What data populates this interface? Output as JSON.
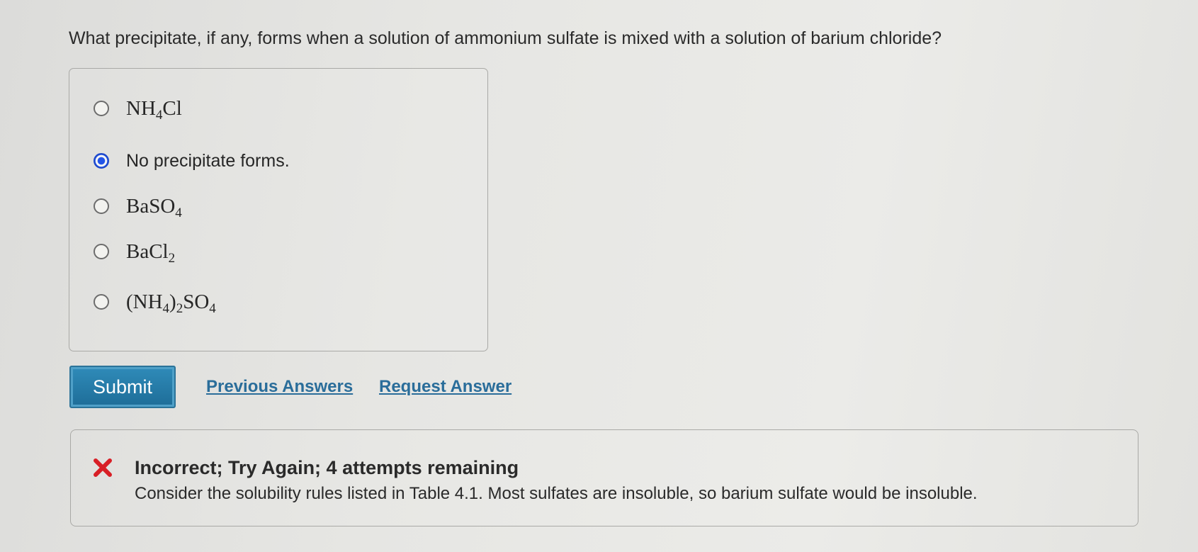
{
  "question": {
    "text": "What precipitate, if any, forms when a solution of ammonium sulfate is mixed with a solution of barium chloride?"
  },
  "options": [
    {
      "parts": [
        "NH",
        "4",
        "Cl"
      ],
      "selected": false
    },
    {
      "text": "No precipitate forms.",
      "selected": true
    },
    {
      "parts": [
        "BaSO",
        "4"
      ],
      "selected": false
    },
    {
      "parts": [
        "BaCl",
        "2"
      ],
      "selected": false
    },
    {
      "parts": [
        "(NH",
        "4",
        ")",
        "2",
        "SO",
        "4"
      ],
      "selected": false
    }
  ],
  "actions": {
    "submit_label": "Submit",
    "previous_answers_label": "Previous Answers",
    "request_answer_label": "Request Answer"
  },
  "feedback": {
    "title": "Incorrect; Try Again; 4 attempts remaining",
    "message": "Consider the solubility rules listed in Table 4.1. Most sulfates are insoluble, so barium sulfate would be insoluble.",
    "icon": "x-icon",
    "icon_color": "#d81f26"
  },
  "colors": {
    "accent": "#2a6d9a",
    "submit_bg": "#1e6d98",
    "radio_selected": "#2355e8"
  }
}
